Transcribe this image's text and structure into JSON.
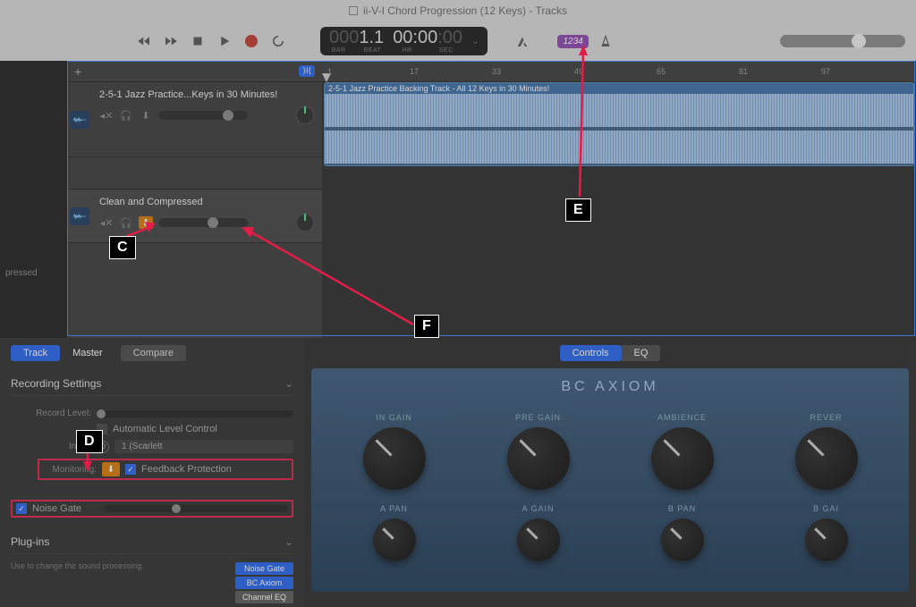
{
  "window": {
    "title": "ii-V-I Chord Progression (12 Keys)  - Tracks"
  },
  "transport": {
    "bar": "1.1",
    "bar_dim": "000",
    "bar_label": "BAR",
    "beat_label": "BEAT",
    "time": "00:00",
    "hr_label": "HR",
    "sec_label": "SEC",
    "count_in": "1234"
  },
  "ruler": {
    "ticks": [
      "1",
      "17",
      "33",
      "49",
      "65",
      "81",
      "97"
    ]
  },
  "tracks": [
    {
      "name": "2-5-1 Jazz Practice...Keys in 30 Minutes!",
      "region_title": "2-5-1 Jazz Practice Backing Track - All 12 Keys in 30 Minutes!",
      "vol_pos": "72",
      "monitor_active": false
    },
    {
      "name": "Clean and Compressed",
      "vol_pos": "55",
      "monitor_active": true
    }
  ],
  "left_gutter_label": "pressed",
  "inspector": {
    "tabs": {
      "track": "Track",
      "master": "Master",
      "compare": "Compare"
    },
    "recording": {
      "title": "Recording Settings",
      "record_level_label": "Record Level:",
      "auto_level": "Automatic Level Control",
      "input_label": "Input:",
      "input_value": "1  (Scarlett",
      "monitoring_label": "Monitoring:",
      "feedback": "Feedback Protection",
      "noise_gate": "Noise Gate"
    },
    "plugins": {
      "title": "Plug-ins",
      "hint": "Use to change the sound processing.",
      "items": [
        "Noise Gate",
        "BC Axiom",
        "Channel EQ"
      ]
    }
  },
  "plugin_view": {
    "tabs": {
      "controls": "Controls",
      "eq": "EQ"
    },
    "title": "BC AXIOM",
    "knobs_top": [
      "IN GAIN",
      "PRE GAIN",
      "AMBIENCE",
      "REVER"
    ],
    "knobs_bot": [
      "A PAN",
      "A GAIN",
      "B PAN",
      "B GAI"
    ]
  },
  "annotations": {
    "c": "C",
    "d": "D",
    "e": "E",
    "f": "F"
  }
}
